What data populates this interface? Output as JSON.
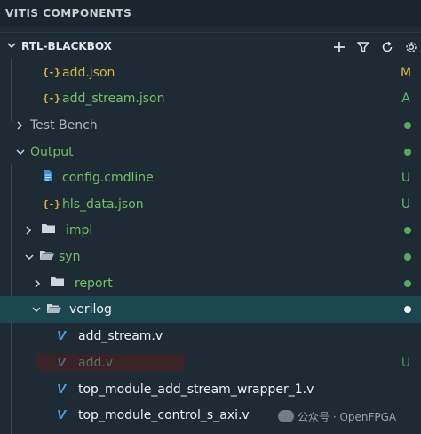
{
  "panel_title": "VITIS COMPONENTS",
  "section": {
    "label": "RTL-BLACKBOX",
    "actions": [
      "add-icon",
      "filter-icon",
      "refresh-icon",
      "settings-icon"
    ]
  },
  "tree": [
    {
      "label": "add.json",
      "status": "M"
    },
    {
      "label": "add_stream.json",
      "status": "A"
    },
    {
      "label": "Test Bench"
    },
    {
      "label": "Output"
    },
    {
      "label": "config.cmdline",
      "status": "U"
    },
    {
      "label": "hls_data.json",
      "status": "U"
    },
    {
      "label": "impl"
    },
    {
      "label": "syn"
    },
    {
      "label": "report"
    },
    {
      "label": "verilog"
    },
    {
      "label": "add_stream.v"
    },
    {
      "label": "add.v",
      "status": "U"
    },
    {
      "label": "top_module_add_stream_wrapper_1.v"
    },
    {
      "label": "top_module_control_s_axi.v"
    }
  ],
  "watermark": {
    "text": "公众号 · OpenFPGA"
  },
  "colors": {
    "modified": "#d8b24a",
    "added": "#5fb970",
    "green_text": "#73c06a",
    "dot_green": "#58a85f",
    "dot_white": "#f2f2f2",
    "icon_blue": "#4aa3df"
  }
}
